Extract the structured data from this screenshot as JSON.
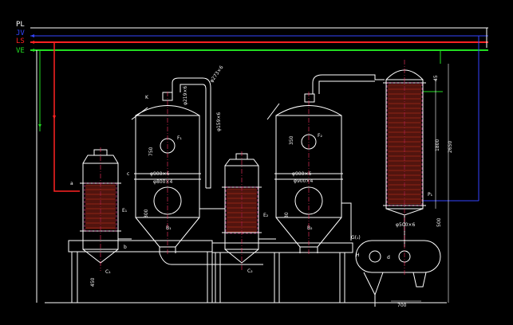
{
  "lines": {
    "items": [
      {
        "code": "PL",
        "color": "#ffffff"
      },
      {
        "code": "JV",
        "color": "#3344ff"
      },
      {
        "code": "LS",
        "color": "#ff2222"
      },
      {
        "code": "VE",
        "color": "#22dd22"
      }
    ]
  },
  "colors": {
    "background": "#000000",
    "equipment": "#ffffff",
    "tube_bundle": "#cc3322",
    "dimension": "#ffffff",
    "centerline": "#ff3366",
    "outline_dashed": "#ff44aa"
  },
  "dims": {
    "d1": "φ219×6",
    "d2": "φ273×6",
    "d3": "750",
    "d4": "φ800×4",
    "d5": "φ900×6",
    "d6": "φ159×6",
    "d7": "350",
    "d8": "φ900×4",
    "d9": "φ900×6",
    "d10": "1800",
    "d11": "2650",
    "d12": "500",
    "d13": "φ500×6",
    "d14": "700",
    "d15": "450",
    "d16": "45",
    "d17": "300",
    "d18": "30"
  },
  "tags": {
    "a": "a",
    "b": "b",
    "c": "c",
    "e1": "E₁",
    "c1": "C₁",
    "f1": "F₁",
    "b1": "B₁",
    "e2": "E₂",
    "f2": "F₂",
    "b2": "B₂",
    "c2": "C₂",
    "g": "G(₁)",
    "h": "H",
    "k": "K",
    "d": "d",
    "p1": "P₁"
  }
}
